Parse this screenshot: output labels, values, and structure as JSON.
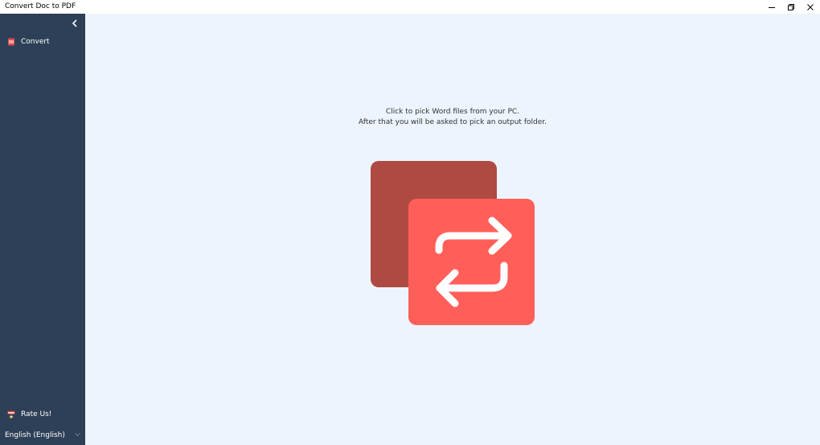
{
  "window": {
    "title": "Convert Doc to PDF"
  },
  "sidebar": {
    "items": [
      {
        "label": "Convert",
        "icon": "pdf-file-icon"
      },
      {
        "label": "Rate Us!",
        "icon": "review-badge-icon"
      }
    ],
    "language": "English (English)"
  },
  "main": {
    "instruction_line1": "Click to pick Word files from your PC.",
    "instruction_line2": "After that you will be asked to pick an output folder."
  },
  "colors": {
    "sidebar_bg": "#2e4057",
    "main_bg": "#edf4fd",
    "back_square": "#af4a42",
    "front_square": "#ff5f58",
    "icon_stroke": "#ffffff"
  }
}
